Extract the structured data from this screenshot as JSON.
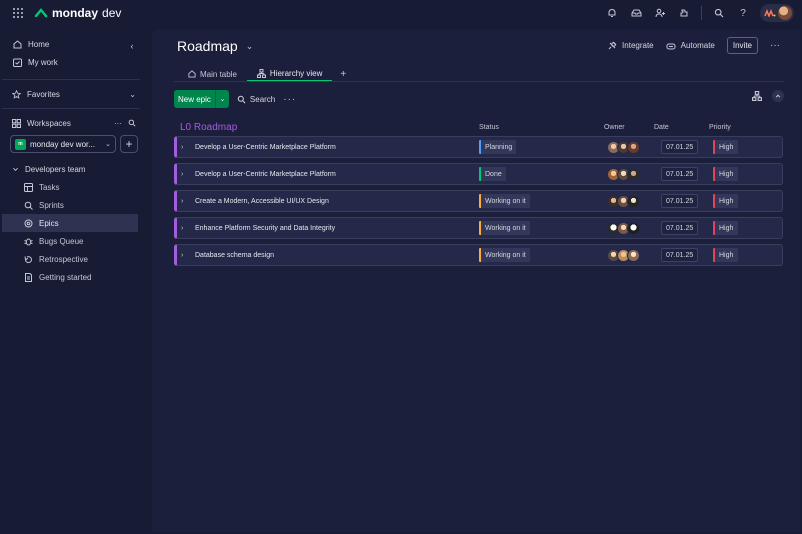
{
  "app": {
    "brand_name": "monday",
    "brand_product": "dev"
  },
  "topbar": {
    "icons": [
      "bell-icon",
      "inbox-icon",
      "invite-members-icon",
      "integrations-icon",
      "search-icon",
      "help-icon"
    ]
  },
  "sidebar": {
    "home": "Home",
    "my_work": "My work",
    "favorites": "Favorites",
    "workspaces": "Workspaces",
    "workspace_selected": "monday dev wor...",
    "workspace_badge": "m",
    "team": "Developers team",
    "items": [
      {
        "label": "Tasks",
        "icon": "board-icon"
      },
      {
        "label": "Sprints",
        "icon": "sprint-icon"
      },
      {
        "label": "Epics",
        "icon": "epic-icon"
      },
      {
        "label": "Bugs Queue",
        "icon": "bug-icon"
      },
      {
        "label": "Retrospective",
        "icon": "retro-icon"
      },
      {
        "label": "Getting started",
        "icon": "doc-icon"
      }
    ],
    "active_item": "Epics"
  },
  "board": {
    "title": "Roadmap",
    "integrate": "Integrate",
    "automate": "Automate",
    "invite": "Invite",
    "tabs": [
      {
        "label": "Main table"
      },
      {
        "label": "Hierarchy view"
      }
    ],
    "active_tab": "Hierarchy view",
    "new_button": "New epic",
    "search": "Search",
    "group_title": "L0 Roadmap",
    "columns": {
      "status": "Status",
      "owner": "Owner",
      "date": "Date",
      "priority": "Priority"
    },
    "rows": [
      {
        "name": "Develop a User-Centric Marketplace Platform",
        "status": "Planning",
        "status_color": "#579bfc",
        "date": "07.01.25",
        "priority": "High"
      },
      {
        "name": "Develop a User-Centric Marketplace Platform",
        "status": "Done",
        "status_color": "#00c875",
        "date": "07.01.25",
        "priority": "High"
      },
      {
        "name": "Create a Modern, Accessible UI/UX Design",
        "status": "Working on it",
        "status_color": "#fdab3d",
        "date": "07.01.25",
        "priority": "High"
      },
      {
        "name": "Enhance Platform Security and Data Integrity",
        "status": "Working on it",
        "status_color": "#fdab3d",
        "date": "07.01.25",
        "priority": "High"
      },
      {
        "name": "Database schema design",
        "status": "Working on it",
        "status_color": "#fdab3d",
        "date": "07.01.25",
        "priority": "High"
      }
    ],
    "group_color": "#a25ddc",
    "priority_color": "#e2445c"
  }
}
